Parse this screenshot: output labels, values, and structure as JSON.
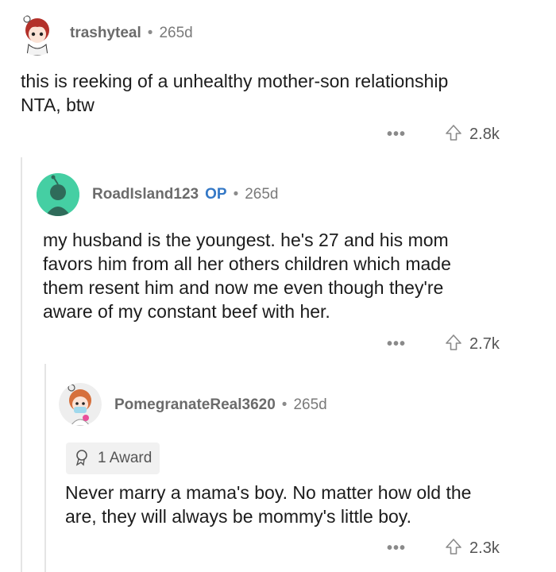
{
  "comments": [
    {
      "username": "trashyteal",
      "age": "265d",
      "lines": [
        "this is reeking of a unhealthy mother-son relationship",
        "NTA, btw"
      ],
      "more": "•••",
      "score": "2.8k"
    },
    {
      "username": "RoadIsland123",
      "op": "OP",
      "age": "265d",
      "lines": [
        "my husband is the youngest. he's 27 and his mom",
        "favors him from all her others children which made",
        "them resent him and now me even though they're",
        "aware of my constant beef with her."
      ],
      "more": "•••",
      "score": "2.7k"
    },
    {
      "username": "PomegranateReal3620",
      "age": "265d",
      "award": "1 Award",
      "lines": [
        "Never marry a mama's boy. No matter how old the",
        "are, they will always be mommy's little boy."
      ],
      "more": "•••",
      "score": "2.3k"
    }
  ],
  "separator": "•",
  "icons": [
    "avatar",
    "upvote-arrow-icon",
    "award-icon"
  ],
  "colors": {
    "op_badge": "#3478c6",
    "avatar2_bg": "#45cfa3",
    "thread_line": "#e5e5e5"
  }
}
